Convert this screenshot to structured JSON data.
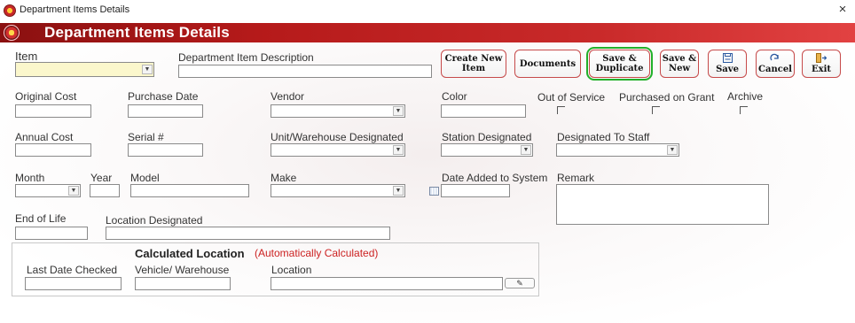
{
  "window": {
    "title": "Department Items Details",
    "close_glyph": "×"
  },
  "banner": {
    "title": "Department Items Details"
  },
  "toolbar": {
    "create_new": [
      "Create New",
      "Item"
    ],
    "documents": "Documents",
    "save_duplicate": [
      "Save &",
      "Duplicate"
    ],
    "save_new": [
      "Save &",
      "New"
    ],
    "save": "Save",
    "cancel": "Cancel",
    "exit": "Exit",
    "icons": {
      "save": "floppy-disk-icon",
      "cancel": "undo-arrow-icon",
      "exit": "exit-door-icon"
    },
    "highlight_color": "#22b02a"
  },
  "form": {
    "item": {
      "label": "Item",
      "value": "",
      "field_color": "#fbf7cc"
    },
    "description": {
      "label": "Department Item Description",
      "value": ""
    },
    "original_cost": {
      "label": "Original Cost",
      "value": ""
    },
    "purchase_date": {
      "label": "Purchase Date",
      "value": ""
    },
    "vendor": {
      "label": "Vendor",
      "value": ""
    },
    "color": {
      "label": "Color",
      "value": ""
    },
    "out_of_service": {
      "label": "Out of Service",
      "checked": false
    },
    "purchased_on_grant": {
      "label": "Purchased on Grant",
      "checked": false
    },
    "archive": {
      "label": "Archive",
      "checked": false
    },
    "annual_cost": {
      "label": "Annual  Cost",
      "value": ""
    },
    "serial": {
      "label": "Serial #",
      "value": ""
    },
    "unit_warehouse": {
      "label": "Unit/Warehouse Designated",
      "value": ""
    },
    "station": {
      "label": "Station Designated",
      "value": ""
    },
    "staff": {
      "label": "Designated To Staff",
      "value": ""
    },
    "month": {
      "label": "Month",
      "value": ""
    },
    "year": {
      "label": "Year",
      "value": ""
    },
    "model": {
      "label": "Model",
      "value": ""
    },
    "make": {
      "label": "Make",
      "value": ""
    },
    "date_added": {
      "label": "Date Added to System",
      "value": ""
    },
    "remark": {
      "label": "Remark",
      "value": ""
    },
    "end_of_life": {
      "label": "End of Life",
      "value": ""
    },
    "location_designated": {
      "label": "Location Designated",
      "value": ""
    }
  },
  "calculated": {
    "title": "Calculated  Location",
    "note": "(Automatically Calculated)",
    "note_color": "#cc2222",
    "last_checked": {
      "label": "Last Date Checked",
      "value": ""
    },
    "vehicle_warehouse": {
      "label": "Vehicle/ Warehouse",
      "value": ""
    },
    "location": {
      "label": "Location",
      "value": ""
    }
  },
  "brand": {
    "banner_color": "#b51a1a",
    "button_border": "#c64a4a"
  }
}
